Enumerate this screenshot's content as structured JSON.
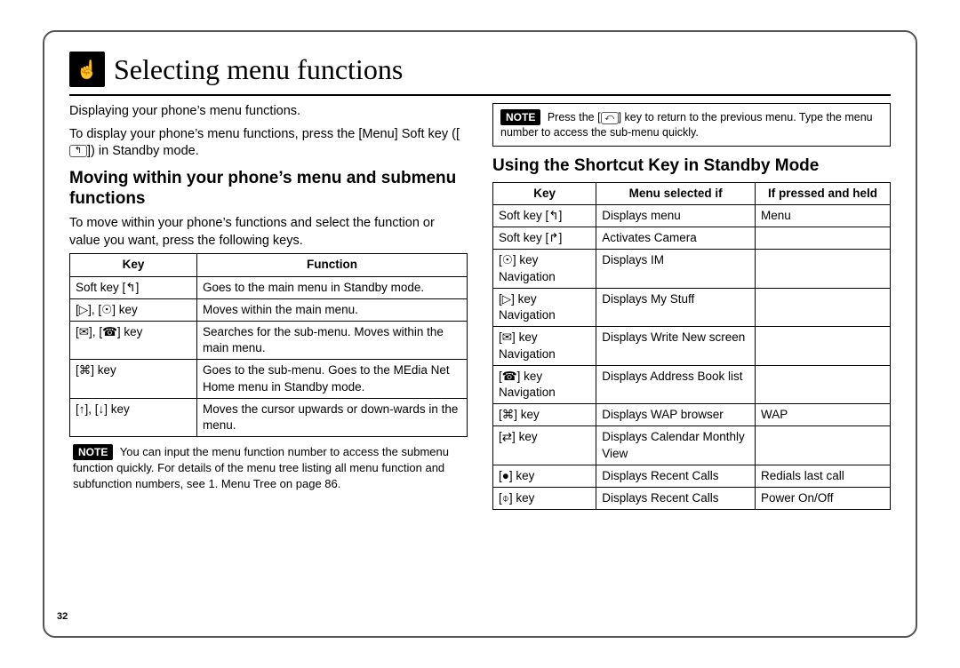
{
  "page_number": "32",
  "header": {
    "title": "Selecting menu functions"
  },
  "left": {
    "intro1": "Displaying your phone’s menu functions.",
    "intro2_a": "To display your phone’s menu functions, press the [Menu] Soft key ([",
    "intro2_b": "]) in Standby mode.",
    "h2": "Moving within your phone’s menu and submenu functions",
    "p2": "To move within your phone’s functions and select the function or value you want, press the following keys.",
    "table": {
      "head": [
        "Key",
        "Function"
      ],
      "rows": [
        {
          "k": "Soft key [↰]",
          "f": "Goes to the main menu in Standby mode."
        },
        {
          "k": "[▷], [☉] key",
          "f": "Moves within the main menu."
        },
        {
          "k": "[✉], [☎] key",
          "f": "Searches for the sub-menu.\nMoves within the main menu."
        },
        {
          "k": "[⌘] key",
          "f": "Goes to the sub-menu.\nGoes to the MEdia Net Home menu in Standby mode."
        },
        {
          "k": "[↑], [↓] key",
          "f": "Moves the cursor upwards or down-wards in the menu."
        }
      ]
    },
    "note": "You can input the menu function number to access the submenu function quickly. For details of the menu tree listing all menu function and subfunction numbers, see 1. Menu Tree on page 86."
  },
  "right": {
    "note_a": "Press the [",
    "note_b": "] key to return to the previous menu. Type the menu number to access the sub-menu quickly.",
    "h2": "Using the Shortcut Key in Standby Mode",
    "table": {
      "head": [
        "Key",
        "Menu selected if",
        "If pressed and held"
      ],
      "rows": [
        {
          "k": "Soft key [↰]",
          "m": "Displays menu",
          "h": "Menu"
        },
        {
          "k": "Soft key [↱]",
          "m": "Activates Camera",
          "h": ""
        },
        {
          "k": "[☉] key Navigation",
          "m": "Displays IM",
          "h": ""
        },
        {
          "k": "[▷] key Navigation",
          "m": "Displays My Stuff",
          "h": ""
        },
        {
          "k": "[✉] key Navigation",
          "m": "Displays Write New screen",
          "h": ""
        },
        {
          "k": "[☎] key Navigation",
          "m": "Displays Address Book list",
          "h": ""
        },
        {
          "k": "[⌘] key",
          "m": "Displays WAP browser",
          "h": "WAP"
        },
        {
          "k": "[⇄] key",
          "m": "Displays Calendar Monthly View",
          "h": ""
        },
        {
          "k": "[●] key",
          "m": "Displays Recent Calls",
          "h": "Redials last call"
        },
        {
          "k": "[⌽] key",
          "m": "Displays Recent Calls",
          "h": "Power On/Off"
        }
      ]
    }
  },
  "noteLabel": "NOTE"
}
